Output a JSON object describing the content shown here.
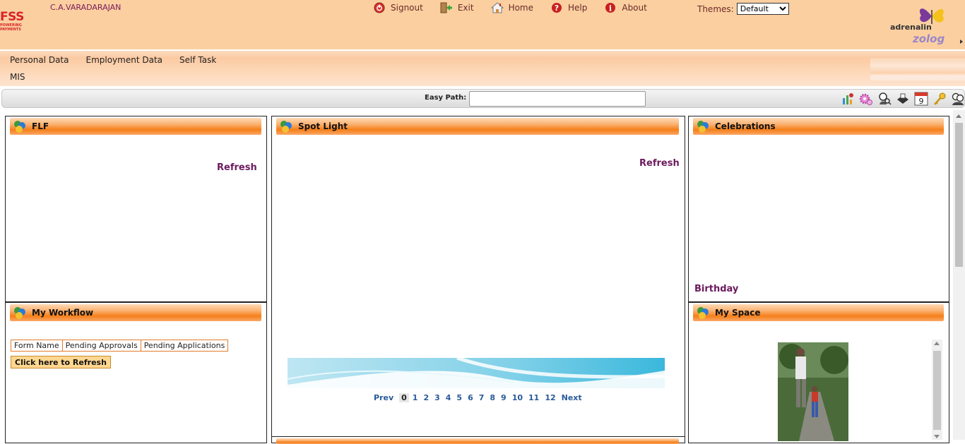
{
  "header": {
    "logo_main": "FSS",
    "logo_tag_line1": "POWERING",
    "logo_tag_line2": "PAYMENTS",
    "user_name": "C.A.VARADARAJAN",
    "nav": [
      {
        "label": "Signout",
        "icon": "signout-icon"
      },
      {
        "label": "Exit",
        "icon": "exit-icon"
      },
      {
        "label": "Home",
        "icon": "home-icon"
      },
      {
        "label": "Help",
        "icon": "help-icon"
      },
      {
        "label": "About",
        "icon": "about-icon"
      }
    ],
    "themes_label": "Themes:",
    "themes_selected": "Default",
    "brand_adrenalin": "adrenalin",
    "brand_zolog": "zolog"
  },
  "menu": {
    "row1": [
      "Personal Data",
      "Employment Data",
      "Self Task"
    ],
    "row2": "MIS"
  },
  "pathbar": {
    "label": "Easy Path:",
    "value": "",
    "tools": [
      "reports-icon",
      "settings-gear-icon",
      "user-search-icon",
      "inbox-icon",
      "calendar-icon",
      "key-icon",
      "people-icon"
    ],
    "calendar_day": "9"
  },
  "panels": {
    "flf": {
      "title": "FLF",
      "refresh": "Refresh"
    },
    "spotlight": {
      "title": "Spot Light",
      "refresh": "Refresh"
    },
    "celebrations": {
      "title": "Celebrations",
      "birthday": "Birthday"
    },
    "workflow": {
      "title": "My Workflow",
      "columns": [
        "Form Name",
        "Pending Approvals",
        "Pending Applications"
      ],
      "refresh_button": "Click here to Refresh"
    },
    "myspace": {
      "title": "My Space"
    }
  },
  "pager": {
    "prev": "Prev",
    "pages": [
      "0",
      "1",
      "2",
      "3",
      "4",
      "5",
      "6",
      "7",
      "8",
      "9",
      "10",
      "11",
      "12"
    ],
    "current": "0",
    "next": "Next"
  },
  "colors": {
    "header_bg": "#fbcfa0",
    "panel_title_orange": "#f57f1a",
    "link_purple": "#6b1a5c",
    "pager_blue": "#2a5a9a"
  }
}
